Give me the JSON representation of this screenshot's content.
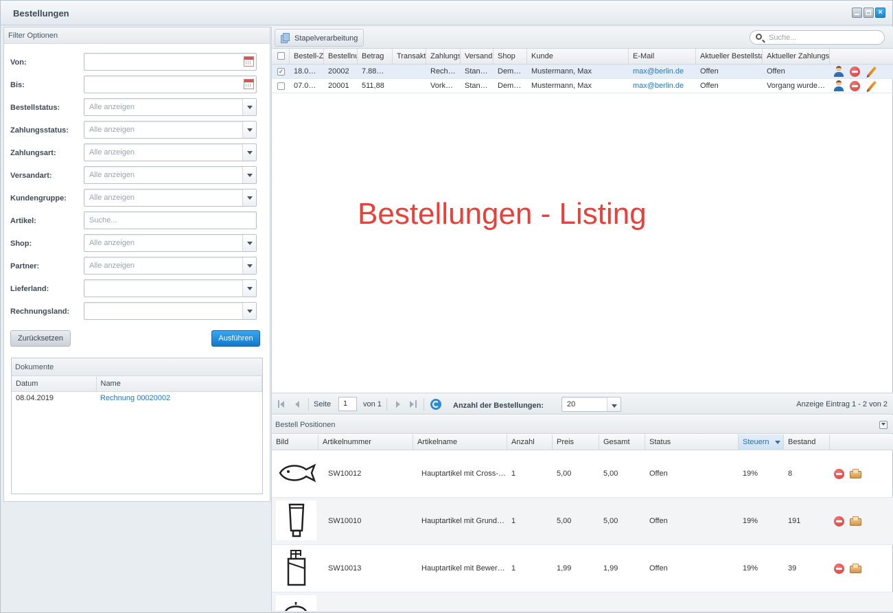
{
  "window": {
    "title": "Bestellungen"
  },
  "filter": {
    "header": "Filter Optionen",
    "fields": [
      {
        "label": "Von:",
        "value": "",
        "type": "date"
      },
      {
        "label": "Bis:",
        "value": "",
        "type": "date"
      },
      {
        "label": "Bestellstatus:",
        "placeholder": "Alle anzeigen",
        "type": "select"
      },
      {
        "label": "Zahlungsstatus:",
        "placeholder": "Alle anzeigen",
        "type": "select"
      },
      {
        "label": "Zahlungsart:",
        "placeholder": "Alle anzeigen",
        "type": "select"
      },
      {
        "label": "Versandart:",
        "placeholder": "Alle anzeigen",
        "type": "select"
      },
      {
        "label": "Kundengruppe:",
        "placeholder": "Alle anzeigen",
        "type": "select"
      },
      {
        "label": "Artikel:",
        "placeholder": "Suche...",
        "type": "text"
      },
      {
        "label": "Shop:",
        "placeholder": "Alle anzeigen",
        "type": "select"
      },
      {
        "label": "Partner:",
        "placeholder": "Alle anzeigen",
        "type": "select"
      },
      {
        "label": "Lieferland:",
        "placeholder": "",
        "type": "select"
      },
      {
        "label": "Rechnungsland:",
        "placeholder": "",
        "type": "select"
      }
    ],
    "reset_label": "Zurücksetzen",
    "apply_label": "Ausführen"
  },
  "documents": {
    "header": "Dokumente",
    "columns": [
      "Datum",
      "Name"
    ],
    "rows": [
      {
        "date": "08.04.2019",
        "name": "Rechnung 00020002"
      }
    ]
  },
  "toolbar": {
    "batch_label": "Stapelverarbeitung",
    "search_placeholder": "Suche..."
  },
  "orders": {
    "columns": [
      "Bestell-Z",
      "Bestellnu",
      "Betrag",
      "Transakt",
      "Zahlungs",
      "Versand",
      "Shop",
      "Kunde",
      "E-Mail",
      "Aktueller Bestellsta",
      "Aktueller Zahlungs"
    ],
    "rows": [
      {
        "checked": true,
        "date": "18.0…",
        "number": "20002",
        "amount": "7.88…",
        "transaction": "",
        "payment": "Rech…",
        "shipping": "Stan…",
        "shop": "Dem…",
        "customer": "Mustermann, Max",
        "email": "max@berlin.de",
        "order_status": "Offen",
        "payment_status": "Offen"
      },
      {
        "checked": false,
        "date": "07.0…",
        "number": "20001",
        "amount": "511,88",
        "transaction": "",
        "payment": "Vork…",
        "shipping": "Stan…",
        "shop": "Dem…",
        "customer": "Mustermann, Max",
        "email": "max@berlin.de",
        "order_status": "Offen",
        "payment_status": "Vorgang wurde…"
      }
    ]
  },
  "overlay_text": "Bestellungen - Listing",
  "pager": {
    "page_label": "Seite",
    "page_value": "1",
    "of_label": "von 1",
    "count_label": "Anzahl der Bestellungen:",
    "count_value": "20",
    "display_info": "Anzeige Eintrag 1 - 2 von 2"
  },
  "positions": {
    "header": "Bestell Positionen",
    "columns": [
      "Bild",
      "Artikelnummer",
      "Artikelname",
      "Anzahl",
      "Preis",
      "Gesamt",
      "Status",
      "Steuern",
      "Bestand"
    ],
    "rows": [
      {
        "image": "fish-icon",
        "article_no": "SW10012",
        "name": "Hauptartikel mit Cross-…",
        "qty": "1",
        "price": "5,00",
        "total": "5,00",
        "status": "Offen",
        "tax": "19%",
        "stock": "8"
      },
      {
        "image": "tube-icon",
        "article_no": "SW10010",
        "name": "Hauptartikel mit Grund…",
        "qty": "1",
        "price": "5,00",
        "total": "5,00",
        "status": "Offen",
        "tax": "19%",
        "stock": "191"
      },
      {
        "image": "chocolate-icon",
        "article_no": "SW10013",
        "name": "Hauptartikel mit Bewer…",
        "qty": "1",
        "price": "1,99",
        "total": "1,99",
        "status": "Offen",
        "tax": "19%",
        "stock": "39"
      }
    ]
  }
}
